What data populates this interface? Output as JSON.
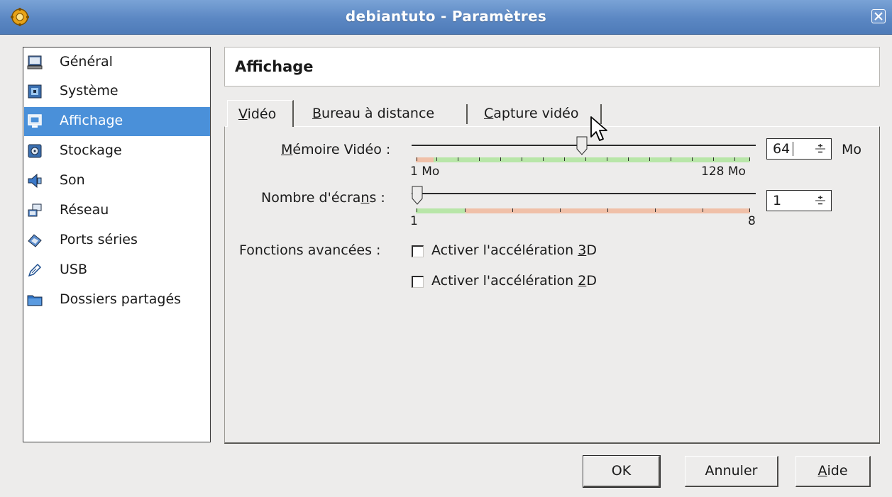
{
  "window": {
    "title": "debiantuto - Paramètres"
  },
  "sidebar": {
    "items": [
      {
        "label": "Général",
        "icon": "monitor-icon",
        "selected": false
      },
      {
        "label": "Système",
        "icon": "chip-icon",
        "selected": false
      },
      {
        "label": "Affichage",
        "icon": "display-icon",
        "selected": true
      },
      {
        "label": "Stockage",
        "icon": "disk-icon",
        "selected": false
      },
      {
        "label": "Son",
        "icon": "speaker-icon",
        "selected": false
      },
      {
        "label": "Réseau",
        "icon": "network-icon",
        "selected": false
      },
      {
        "label": "Ports séries",
        "icon": "serial-port-icon",
        "selected": false
      },
      {
        "label": "USB",
        "icon": "usb-icon",
        "selected": false
      },
      {
        "label": "Dossiers partagés",
        "icon": "folder-icon",
        "selected": false
      }
    ]
  },
  "header": {
    "title": "Affichage"
  },
  "tabs": [
    {
      "label": "Vidéo",
      "mnemonic": "V",
      "rest": "idéo",
      "active": true
    },
    {
      "label": "Bureau à distance",
      "mnemonic": "B",
      "rest": "ureau à distance",
      "active": false
    },
    {
      "label": "Capture vidéo",
      "mnemonic": "C",
      "rest": "apture vidéo",
      "active": false
    }
  ],
  "video": {
    "memory": {
      "label_pre": "",
      "label_mn": "M",
      "label_post": "émoire Vidéo :",
      "value": "64",
      "unit": "Mo",
      "min_label": "1 Mo",
      "max_label": "128 Mo",
      "level": 0.5
    },
    "screens": {
      "label_pre": "Nombre d'écra",
      "label_mn": "n",
      "label_post": "s :",
      "value": "1",
      "min_label": "1",
      "max_label": "8",
      "level": 0
    },
    "advanced": {
      "label": "Fonctions avancées :",
      "accel3d": {
        "pre": "Activer l'accélération ",
        "mn": "3",
        "post": "D",
        "checked": false
      },
      "accel2d": {
        "pre": "Activer l'accélération ",
        "mn": "2",
        "post": "D",
        "checked": false
      }
    }
  },
  "buttons": {
    "ok": "OK",
    "cancel": "Annuler",
    "help_mn": "A",
    "help_rest": "ide"
  },
  "colors": {
    "titlebar": "#5b87c3",
    "selection": "#4a90d9",
    "slider_good": "#b8e6a8",
    "slider_bad": "#f0c0a8"
  }
}
